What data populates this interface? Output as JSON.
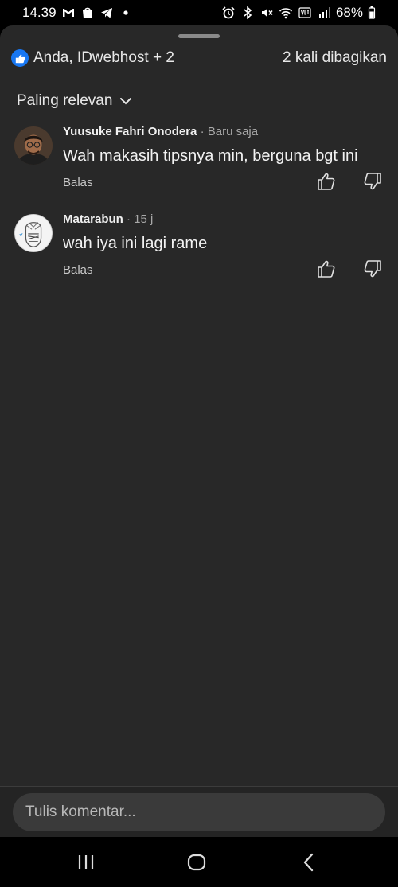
{
  "status": {
    "time": "14.39",
    "battery": "68%",
    "left_icons": [
      "gmail-icon",
      "shopping-bag-icon",
      "telegram-icon",
      "dot-icon"
    ],
    "right_icons": [
      "alarm-icon",
      "bluetooth-icon",
      "mute-icon",
      "wifi-icon",
      "volte-icon",
      "signal-icon",
      "battery-icon"
    ]
  },
  "header": {
    "reactions": "Anda, IDwebhost + 2",
    "shares": "2 kali dibagikan"
  },
  "sort": {
    "label": "Paling relevan"
  },
  "comments": [
    {
      "name": "Yuusuke Fahri Onodera",
      "time": "· Baru saja",
      "text": "Wah makasih tipsnya min, berguna bgt ini",
      "reply": "Balas"
    },
    {
      "name": "Matarabun",
      "time": "· 15 j",
      "text": "wah iya ini lagi rame",
      "reply": "Balas"
    }
  ],
  "composer": {
    "placeholder": "Tulis komentar..."
  },
  "colors": {
    "accent": "#1877f2",
    "sheet": "#282828",
    "input": "#3a3a3a"
  }
}
